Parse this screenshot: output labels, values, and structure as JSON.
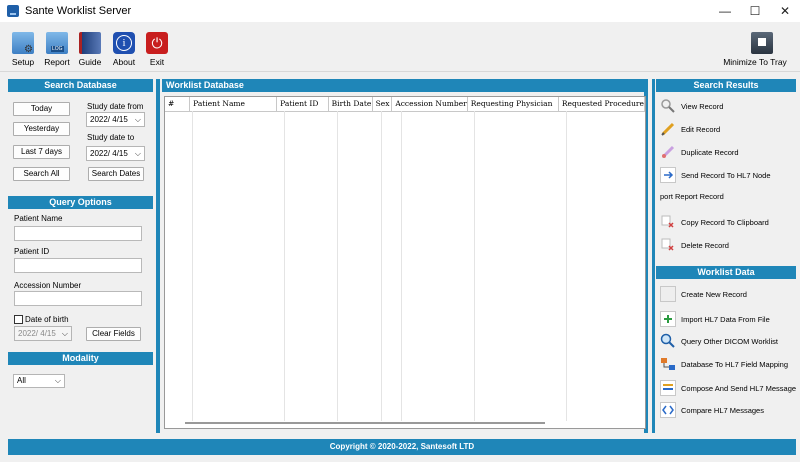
{
  "window": {
    "title": "Sante Worklist Server",
    "minimize": "—",
    "maximize": "☐",
    "close": "✕"
  },
  "toolbar": {
    "setup": "Setup",
    "report": "Report",
    "guide": "Guide",
    "about": "About",
    "exit": "Exit",
    "tray": "Minimize To Tray"
  },
  "search_db": {
    "header": "Search Database",
    "today": "Today",
    "yesterday": "Yesterday",
    "last7": "Last 7 days",
    "search_all": "Search All",
    "study_from_label": "Study date from",
    "study_from_value": "2022/  4/15",
    "study_to_label": "Study date to",
    "study_to_value": "2022/  4/15",
    "search_dates": "Search Dates"
  },
  "query": {
    "header": "Query Options",
    "patient_name_label": "Patient Name",
    "patient_id_label": "Patient ID",
    "accession_label": "Accession Number",
    "dob_label": "Date of birth",
    "dob_value": "2022/  4/15",
    "clear_fields": "Clear Fields"
  },
  "modality": {
    "header": "Modality",
    "value": "All"
  },
  "worklist": {
    "header": "Worklist Database",
    "columns": [
      "#",
      "Patient Name",
      "Patient ID",
      "Birth Date",
      "Sex",
      "Accession Number",
      "Requesting Physician",
      "Requested Procedure"
    ]
  },
  "search_results": {
    "header": "Search Results",
    "items": [
      "View Record",
      "Edit Record",
      "Duplicate Record",
      "Send Record To HL7 Node",
      "port Report Record",
      "Copy Record To Clipboard",
      "Delete Record"
    ]
  },
  "worklist_data": {
    "header": "Worklist Data",
    "items": [
      "Create New Record",
      "Import HL7 Data From File",
      "Query Other DICOM Worklist",
      "Database To HL7 Field Mapping",
      "Compose And Send HL7 Message",
      "Compare HL7 Messages"
    ]
  },
  "footer": {
    "copyright": "Copyright © 2020-2022, Santesoft LTD"
  },
  "colors": {
    "accent": "#1f86b8"
  }
}
